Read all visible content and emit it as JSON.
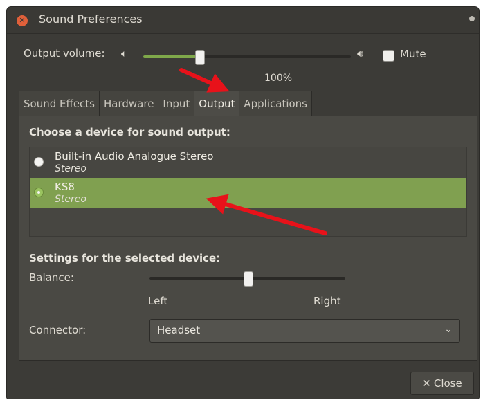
{
  "window": {
    "title": "Sound Preferences"
  },
  "output": {
    "label": "Output volume:",
    "volume_text": "100%",
    "volume_level": 0.27,
    "mute_label": "Mute",
    "low_icon": "speaker-low-icon",
    "high_icon": "speaker-high-icon"
  },
  "tabs": [
    {
      "label": "Sound Effects"
    },
    {
      "label": "Hardware"
    },
    {
      "label": "Input"
    },
    {
      "label": "Output"
    },
    {
      "label": "Applications"
    }
  ],
  "active_tab": "Output",
  "device_section": {
    "heading": "Choose a device for sound output:",
    "devices": [
      {
        "name": "Built-in Audio Analogue Stereo",
        "profile": "Stereo",
        "selected": false
      },
      {
        "name": "KS8",
        "profile": "Stereo",
        "selected": true
      }
    ]
  },
  "settings": {
    "heading": "Settings for the selected device:",
    "balance_label": "Balance:",
    "balance_value": 0.5,
    "left_label": "Left",
    "right_label": "Right",
    "connector_label": "Connector:",
    "connector_value": "Headset"
  },
  "footer": {
    "close_label": "Close"
  },
  "colors": {
    "accent": "#7fa84a",
    "selected_row": "#80a050",
    "annotation_arrow": "#e8121a"
  }
}
